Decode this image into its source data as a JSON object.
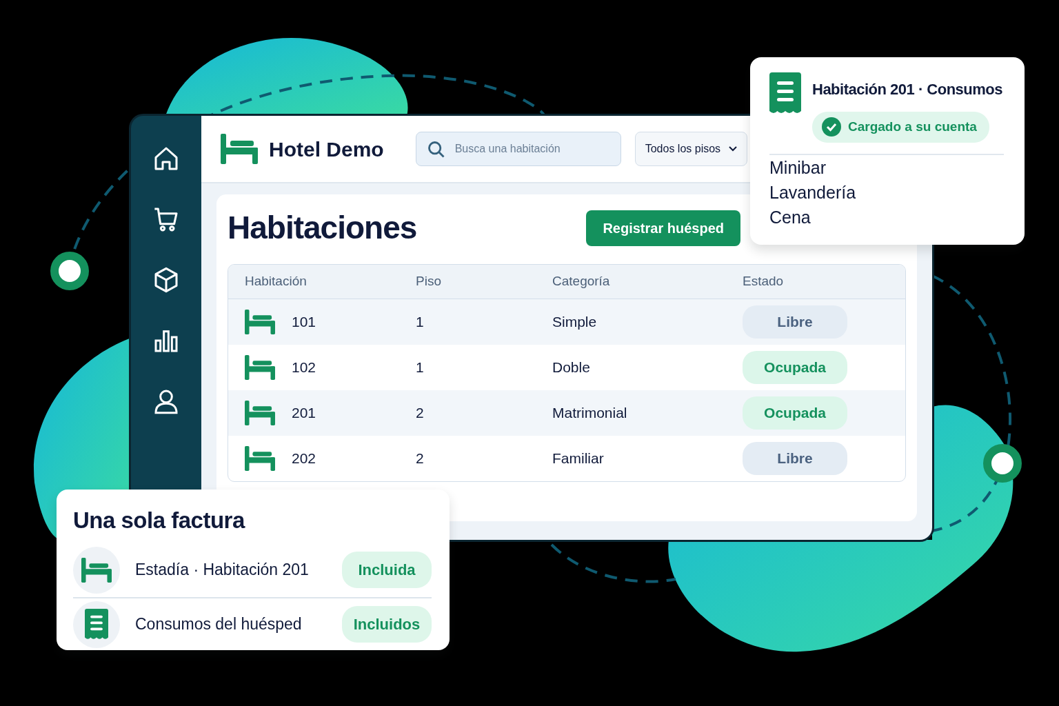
{
  "app": {
    "brand": "Hotel Demo",
    "search": {
      "placeholder": "Busca una habitación"
    },
    "floor_filter": "Todos los pisos"
  },
  "rooms_panel": {
    "title": "Habitaciones",
    "action": "Registrar huésped",
    "table": {
      "columns": [
        "Habitación",
        "Piso",
        "Categoría",
        "Estado"
      ],
      "rows": [
        {
          "room": "101",
          "floor": "1",
          "category": "Simple",
          "status": "Libre",
          "kind": "free"
        },
        {
          "room": "102",
          "floor": "1",
          "category": "Doble",
          "status": "Ocupada",
          "kind": "occupied"
        },
        {
          "room": "201",
          "floor": "2",
          "category": "Matrimonial",
          "status": "Ocupada",
          "kind": "occupied"
        },
        {
          "room": "202",
          "floor": "2",
          "category": "Familiar",
          "status": "Libre",
          "kind": "free"
        }
      ]
    }
  },
  "consumption_card": {
    "title": "Habitación 201 · Consumos",
    "badge": "Cargado a su cuenta",
    "items": [
      "Minibar",
      "Lavandería",
      "Cena"
    ]
  },
  "invoice_card": {
    "title": "Una sola factura",
    "items": [
      {
        "kind": "stay",
        "label": "Estadía · Habitación 201",
        "status": "Incluida"
      },
      {
        "kind": "consumption",
        "label": "Consumos del huésped",
        "status": "Incluidos"
      }
    ]
  }
}
